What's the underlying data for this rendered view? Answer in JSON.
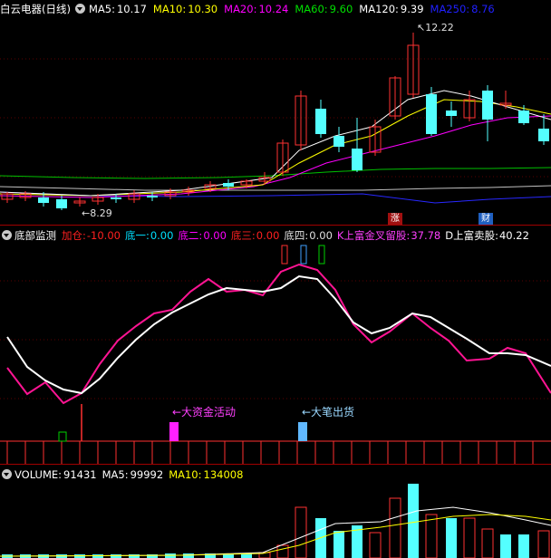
{
  "main_panel": {
    "stock_name": "白云电器",
    "period": "(日线)",
    "ma": [
      {
        "label": "MA5:",
        "value": "10.17",
        "color": "#ffffff"
      },
      {
        "label": "MA10:",
        "value": "10.30",
        "color": "#ffff00"
      },
      {
        "label": "MA20:",
        "value": "10.24",
        "color": "#ff00ff"
      },
      {
        "label": "MA60:",
        "value": "9.60",
        "color": "#00e000"
      },
      {
        "label": "MA120:",
        "value": "9.39",
        "color": "#ffffff"
      },
      {
        "label": "MA250:",
        "value": "8.76",
        "color": "#2020ff"
      }
    ],
    "high_label": "12.22",
    "low_label": "8.29",
    "badge_zhang": "涨",
    "badge_cai": "财"
  },
  "indicator_panel": {
    "title": "底部监测",
    "items": [
      {
        "label": "加仓:",
        "value": "-10.00",
        "color": "#ff2020"
      },
      {
        "label": "底一:",
        "value": "0.00",
        "color": "#00e0ff"
      },
      {
        "label": "底二:",
        "value": "0.00",
        "color": "#ff00ff"
      },
      {
        "label": "底三:",
        "value": "0.00",
        "color": "#ff2020"
      },
      {
        "label": "底四:",
        "value": "0.00",
        "color": "#e0e0e0"
      },
      {
        "label": "K上富金叉留股:",
        "value": "37.78",
        "color": "#ff40ff"
      },
      {
        "label": "D上富卖股:",
        "value": "40.22",
        "color": "#ffffff"
      }
    ],
    "annotation_capital": "←大资金活动",
    "annotation_sell": "←大笔出货"
  },
  "volume_panel": {
    "title": "VOLUME:",
    "volume": "91431",
    "ma5_label": "MA5:",
    "ma5": "99992",
    "ma10_label": "MA10:",
    "ma10": "134008"
  },
  "colors": {
    "up": "#ff3232",
    "down": "#54ffff",
    "k_line": "#ff1493",
    "d_line": "#ffffff"
  }
}
